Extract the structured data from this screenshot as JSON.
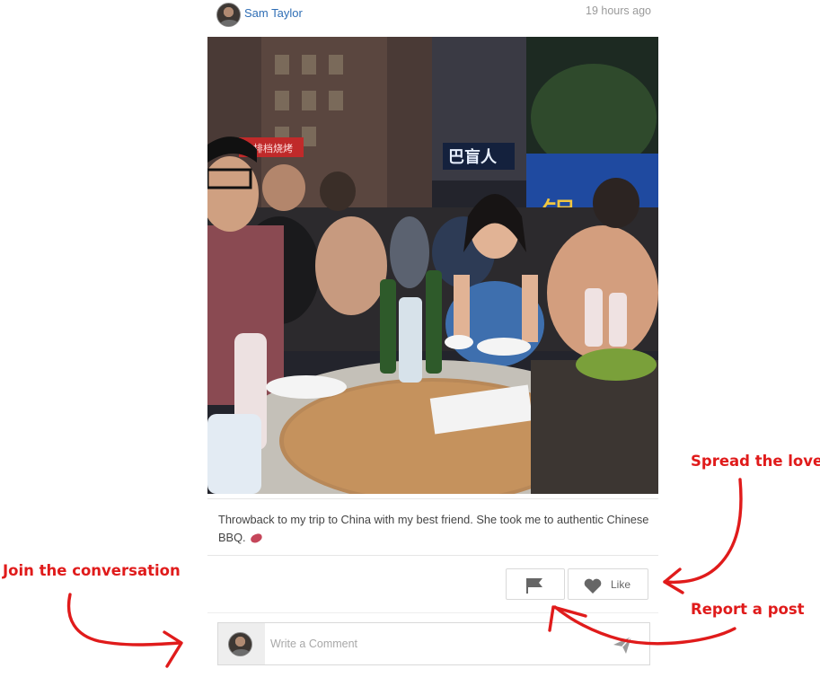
{
  "post": {
    "author_name": "Sam Taylor",
    "timestamp": "19 hours ago",
    "photo_alt": "Night street BBQ in China",
    "caption": "Throwback to my trip to China with my best friend. She took me to authentic Chinese BBQ.",
    "caption_emoji": "meat-emoji"
  },
  "actions": {
    "report_icon": "flag-icon",
    "like_icon": "heart-icon",
    "like_label": "Like"
  },
  "comment": {
    "placeholder": "Write a Comment",
    "send_icon": "paper-plane-icon"
  },
  "photo_signs": {
    "sign_red": "大排档烧烤",
    "sign_blue": "巴盲人",
    "sign_banner": "银"
  },
  "annotations": {
    "join": "Join the conversation",
    "spread": "Spread the love",
    "report": "Report a post"
  },
  "colors": {
    "author_link": "#2f6eb5",
    "annotation": "#e01b1b",
    "divider": "#e6e6e6"
  }
}
